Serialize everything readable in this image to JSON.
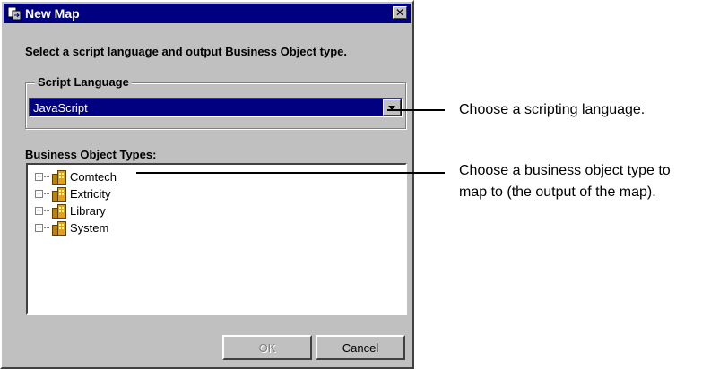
{
  "dialog": {
    "title": "New Map",
    "close_label": "✕",
    "instruction": "Select a script language and output Business Object type.",
    "script_language": {
      "group_label": "Script Language",
      "selected": "JavaScript"
    },
    "business_object_types": {
      "label": "Business Object Types:",
      "items": [
        {
          "label": "Comtech"
        },
        {
          "label": "Extricity"
        },
        {
          "label": "Library"
        },
        {
          "label": "System"
        }
      ]
    },
    "buttons": {
      "ok": "OK",
      "cancel": "Cancel"
    }
  },
  "callouts": {
    "language": "Choose a scripting language.",
    "bo_type_line1": "Choose a business object type to",
    "bo_type_line2": "map to (the output of the map)."
  },
  "colors": {
    "titlebar": "#000080",
    "dialog_bg": "#c0c0c0",
    "selection": "#000080"
  }
}
